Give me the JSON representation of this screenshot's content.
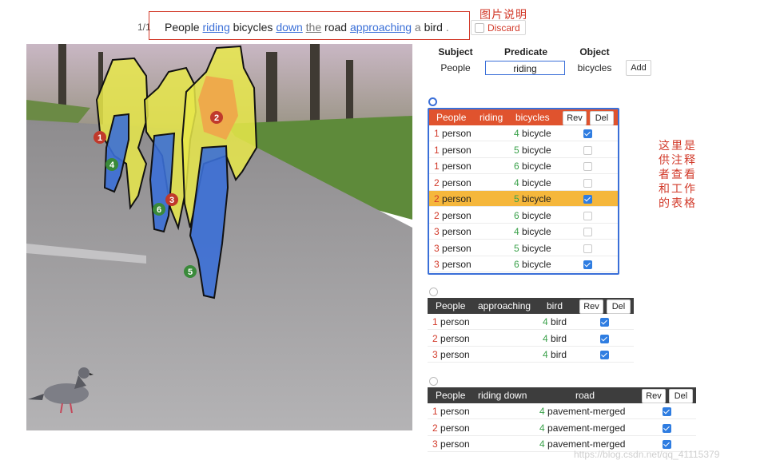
{
  "header": {
    "counter": "1/1",
    "caption_words": [
      {
        "text": "People",
        "style": "plain"
      },
      {
        "text": "riding",
        "style": "link"
      },
      {
        "text": "bicycles",
        "style": "plain"
      },
      {
        "text": "down",
        "style": "link"
      },
      {
        "text": "the",
        "style": "muted-underline"
      },
      {
        "text": "road",
        "style": "plain"
      },
      {
        "text": "approaching",
        "style": "link"
      },
      {
        "text": "a",
        "style": "muted"
      },
      {
        "text": "bird",
        "style": "plain"
      },
      {
        "text": ".",
        "style": "muted"
      }
    ],
    "discard_label": "Discard",
    "annotation_title": "图片说明"
  },
  "side_note": "这里是供注释者查看和工作的表格",
  "editor": {
    "subject_header": "Subject",
    "predicate_header": "Predicate",
    "object_header": "Object",
    "subject_value": "People",
    "predicate_value": "riding",
    "object_value": "bicycles",
    "add_label": "Add"
  },
  "tables": [
    {
      "selected": true,
      "headers": [
        "People",
        "riding",
        "bicycles"
      ],
      "rev_label": "Rev",
      "del_label": "Del",
      "rows": [
        {
          "s_idx": "1",
          "s": "person",
          "o_idx": "4",
          "o": "bicycle",
          "checked": true,
          "highlight": false
        },
        {
          "s_idx": "1",
          "s": "person",
          "o_idx": "5",
          "o": "bicycle",
          "checked": false,
          "highlight": false
        },
        {
          "s_idx": "1",
          "s": "person",
          "o_idx": "6",
          "o": "bicycle",
          "checked": false,
          "highlight": false
        },
        {
          "s_idx": "2",
          "s": "person",
          "o_idx": "4",
          "o": "bicycle",
          "checked": false,
          "highlight": false
        },
        {
          "s_idx": "2",
          "s": "person",
          "o_idx": "5",
          "o": "bicycle",
          "checked": true,
          "highlight": true
        },
        {
          "s_idx": "2",
          "s": "person",
          "o_idx": "6",
          "o": "bicycle",
          "checked": false,
          "highlight": false
        },
        {
          "s_idx": "3",
          "s": "person",
          "o_idx": "4",
          "o": "bicycle",
          "checked": false,
          "highlight": false
        },
        {
          "s_idx": "3",
          "s": "person",
          "o_idx": "5",
          "o": "bicycle",
          "checked": false,
          "highlight": false
        },
        {
          "s_idx": "3",
          "s": "person",
          "o_idx": "6",
          "o": "bicycle",
          "checked": true,
          "highlight": false
        }
      ]
    },
    {
      "selected": false,
      "headers": [
        "People",
        "approaching",
        "bird"
      ],
      "rev_label": "Rev",
      "del_label": "Del",
      "rows": [
        {
          "s_idx": "1",
          "s": "person",
          "o_idx": "4",
          "o": "bird",
          "checked": true,
          "highlight": false
        },
        {
          "s_idx": "2",
          "s": "person",
          "o_idx": "4",
          "o": "bird",
          "checked": true,
          "highlight": false
        },
        {
          "s_idx": "3",
          "s": "person",
          "o_idx": "4",
          "o": "bird",
          "checked": true,
          "highlight": false
        }
      ]
    },
    {
      "selected": false,
      "headers": [
        "People",
        "riding down",
        "road"
      ],
      "rev_label": "Rev",
      "del_label": "Del",
      "rows": [
        {
          "s_idx": "1",
          "s": "person",
          "o_idx": "4",
          "o": "pavement-merged",
          "checked": true,
          "highlight": false
        },
        {
          "s_idx": "2",
          "s": "person",
          "o_idx": "4",
          "o": "pavement-merged",
          "checked": true,
          "highlight": false
        },
        {
          "s_idx": "3",
          "s": "person",
          "o_idx": "4",
          "o": "pavement-merged",
          "checked": true,
          "highlight": false
        }
      ]
    }
  ],
  "image_markers": {
    "person_markers": [
      "1",
      "2",
      "3"
    ],
    "bicycle_markers": [
      "4",
      "5",
      "6"
    ]
  },
  "colors": {
    "accent_red": "#d23a2a",
    "link_blue": "#3a6fd8",
    "table1_header": "#e0532e",
    "table_header_dark": "#3d3d3d",
    "highlight_row": "#f5b73c",
    "person_mask": "#e8e84a",
    "bicycle_mask": "#3b6fd6",
    "person_marker": "#c0392b",
    "bicycle_marker": "#3a8a3a"
  },
  "watermark": "https://blog.csdn.net/qq_41115379"
}
